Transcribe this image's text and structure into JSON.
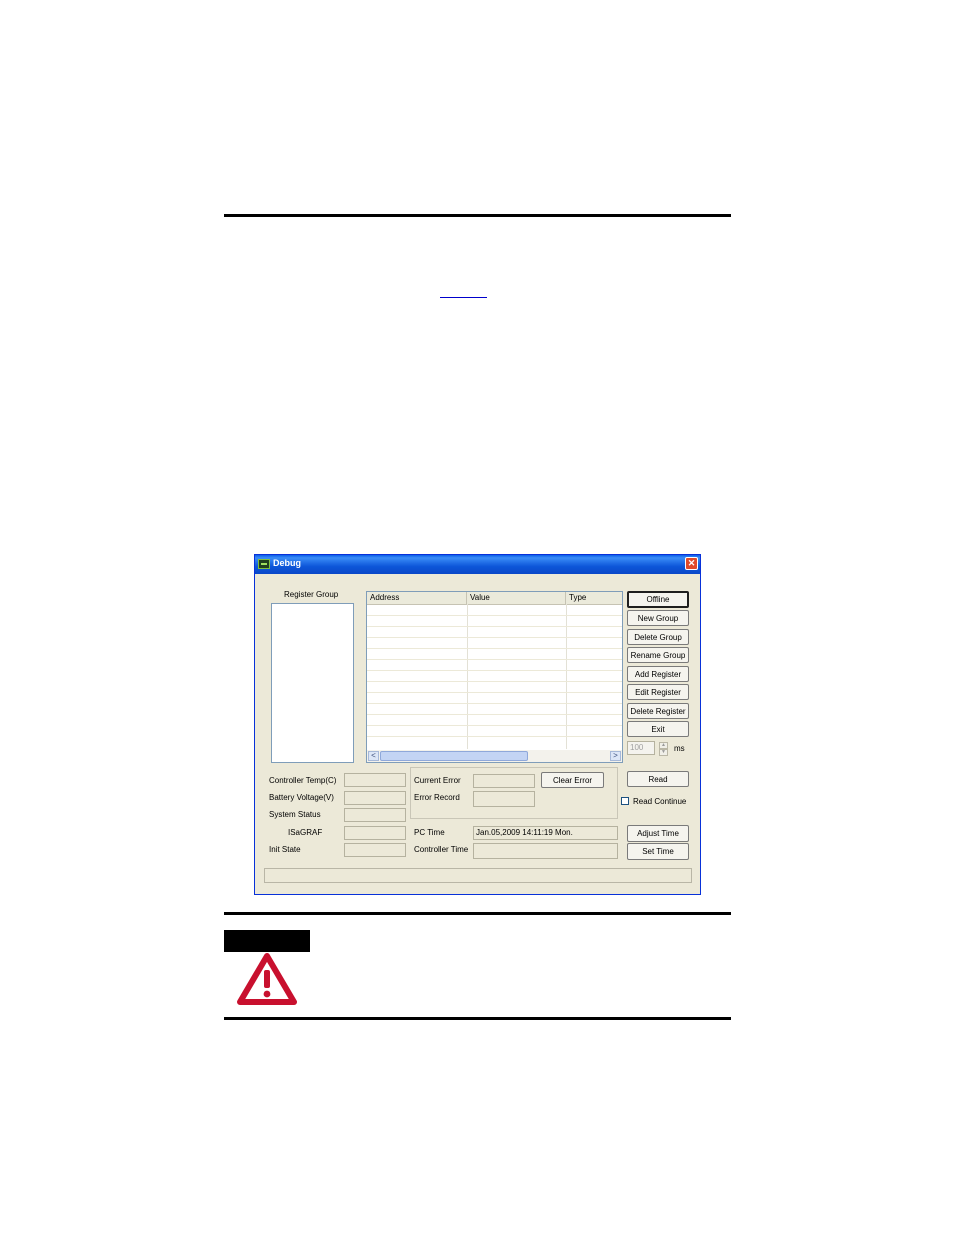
{
  "window": {
    "title": "Debug",
    "close_glyph": "✕",
    "register_group_label": "Register Group",
    "table_columns": [
      "Address",
      "Value",
      "Type"
    ],
    "buttons": {
      "offline": "Offline",
      "new_group": "New Group",
      "delete_group": "Delete Group",
      "rename_group": "Rename Group",
      "add_register": "Add Register",
      "edit_register": "Edit Register",
      "delete_register": "Delete Register",
      "exit": "Exit",
      "clear_error": "Clear Error",
      "read": "Read",
      "adjust_time": "Adjust Time",
      "set_time": "Set Time"
    },
    "interval": {
      "value": "100",
      "unit": "ms"
    },
    "status_labels": {
      "controller_temp": "Controller Temp(C)",
      "battery_voltage": "Battery Voltage(V)",
      "system_status": "System Status",
      "isagraf": "ISaGRAF",
      "init_state": "Init State"
    },
    "error_labels": {
      "current_error": "Current Error",
      "error_record": "Error Record"
    },
    "time": {
      "pc_time_label": "PC Time",
      "pc_time_value": "Jan.05,2009 14:11:19  Mon.",
      "controller_time_label": "Controller Time",
      "controller_time_value": ""
    },
    "read_continue_label": "Read Continue",
    "scroll_left": "<",
    "scroll_right": ">"
  },
  "colors": {
    "window_bg": "#ece9d8",
    "titlebar": "#0a5ee8",
    "warning_red": "#c8102e"
  },
  "icons": [
    "app-icon",
    "close-icon",
    "warning-triangle-icon"
  ]
}
